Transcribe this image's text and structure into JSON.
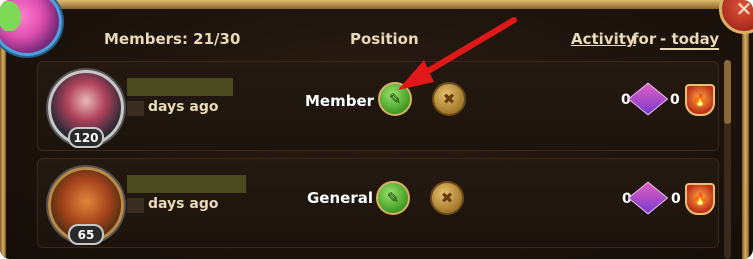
{
  "header": {
    "members_label": "Members: 21/30",
    "position_label": "Position",
    "activity_label": "Activity",
    "for_label": "for",
    "period_label": "- today"
  },
  "members": [
    {
      "level": "120",
      "days_label": "days ago",
      "position": "Member",
      "stat_gems": "0",
      "stat_fire": "0"
    },
    {
      "level": "65",
      "days_label": "days ago",
      "position": "General",
      "stat_gems": "0",
      "stat_fire": "0"
    }
  ],
  "icons": {
    "edit": "pencil-icon",
    "remove": "x-icon",
    "gem": "gem-icon",
    "fire": "fire-shield-icon",
    "close": "close-icon"
  },
  "colors": {
    "accent_gold": "#d9b064",
    "annotation_arrow": "#e01818"
  }
}
